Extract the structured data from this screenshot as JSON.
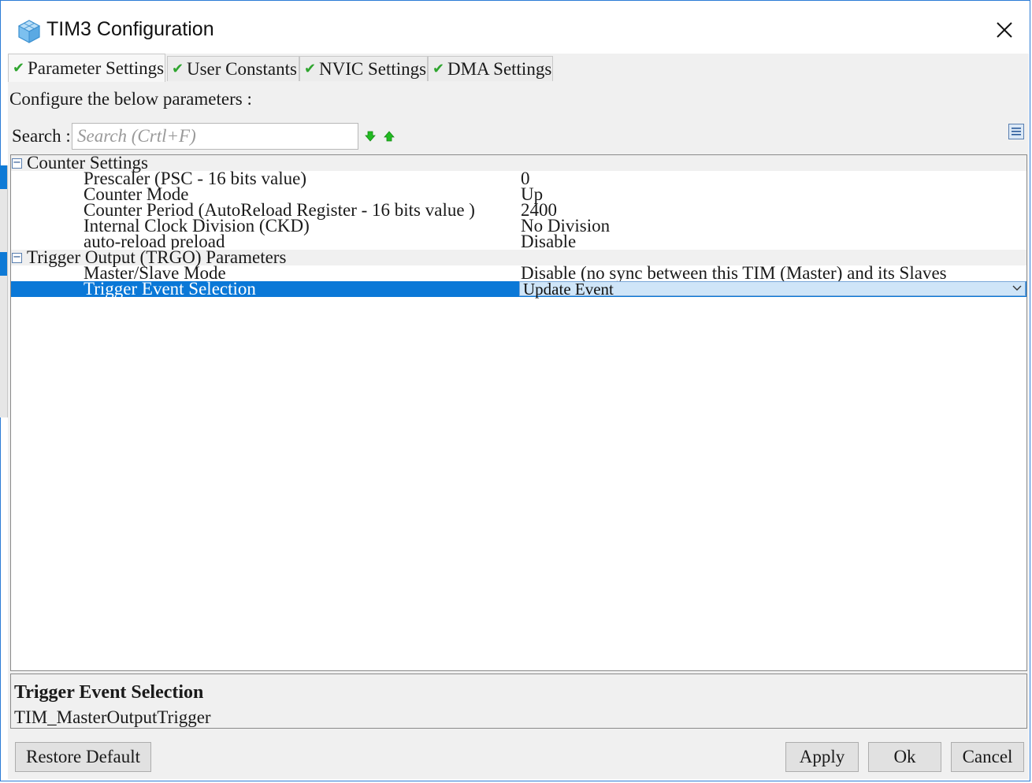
{
  "window": {
    "title": "TIM3 Configuration",
    "icons": {
      "app": "cube-icon",
      "close": "close-icon"
    }
  },
  "tabs": [
    {
      "label": "Parameter Settings",
      "active": true,
      "icon": "check-icon"
    },
    {
      "label": "User Constants",
      "active": false,
      "icon": "check-icon"
    },
    {
      "label": "NVIC Settings",
      "active": false,
      "icon": "check-icon"
    },
    {
      "label": "DMA Settings",
      "active": false,
      "icon": "check-icon"
    }
  ],
  "main": {
    "configure_label": "Configure the below parameters :",
    "search": {
      "label": "Search :",
      "placeholder": "Search (Crtl+F)",
      "value": ""
    },
    "toolbar_icons": [
      "arrow-down-icon",
      "arrow-up-icon",
      "list-view-icon"
    ]
  },
  "tree": {
    "groups": [
      {
        "name": "Counter Settings",
        "expanded": true,
        "params": [
          {
            "name": "Prescaler (PSC - 16 bits value)",
            "value": "0"
          },
          {
            "name": "Counter Mode",
            "value": "Up"
          },
          {
            "name": "Counter Period (AutoReload Register - 16 bits value )",
            "value": "2400"
          },
          {
            "name": "Internal Clock Division (CKD)",
            "value": "No Division"
          },
          {
            "name": "auto-reload preload",
            "value": "Disable"
          }
        ]
      },
      {
        "name": "Trigger Output (TRGO) Parameters",
        "expanded": true,
        "params": [
          {
            "name": "Master/Slave Mode",
            "value": "Disable (no sync between this TIM (Master) and its Slaves"
          },
          {
            "name": "Trigger Event Selection",
            "value": "Update Event",
            "selected": true
          }
        ]
      }
    ],
    "toggle_symbol": "−"
  },
  "description": {
    "title": "Trigger Event Selection",
    "text": "TIM_MasterOutputTrigger"
  },
  "buttons": {
    "restore": "Restore Default",
    "apply": "Apply",
    "ok": "Ok",
    "cancel": "Cancel"
  },
  "colors": {
    "selection": "#0a78d7",
    "combo_bg": "#cfe5f8",
    "check": "#2fa52f",
    "arrows": "#22bb22",
    "window_border": "#2b7bd6"
  }
}
